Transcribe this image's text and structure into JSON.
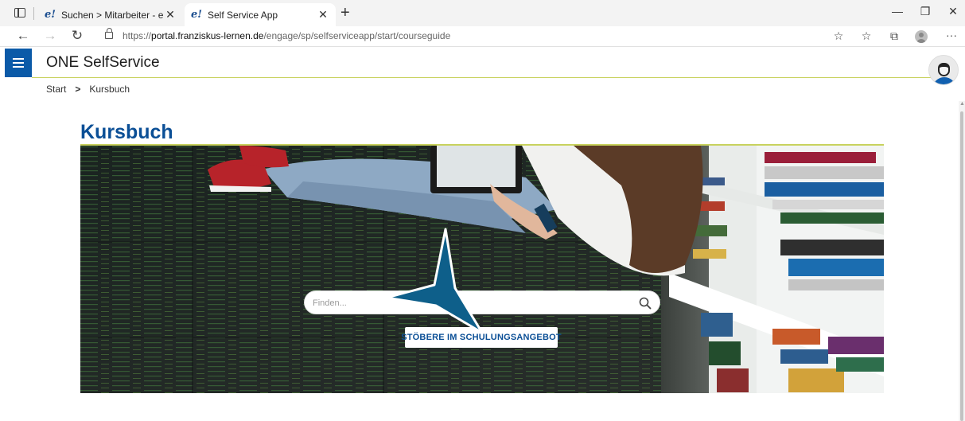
{
  "browser": {
    "tabs": [
      {
        "favicon": "e!",
        "title": "Suchen > Mitarbeiter - engage!",
        "close": "✕"
      },
      {
        "favicon": "e!",
        "title": "Self Service App",
        "close": "✕"
      }
    ],
    "new_tab": "+",
    "window_controls": {
      "minimize": "—",
      "maximize": "❐",
      "close": "✕"
    },
    "nav": {
      "back": "←",
      "forward": "→",
      "reload": "↻"
    },
    "url": {
      "prefix": "https://",
      "host": "portal.franziskus-lernen.de",
      "path": "/engage/sp/selfserviceapp/start/courseguide"
    },
    "toolbar_icons": [
      "add-favorite-icon",
      "favorites-icon",
      "collections-icon",
      "profile-icon",
      "more-icon"
    ],
    "toolbar_glyphs": {
      "add_favorite": "☆",
      "favorites": "☆",
      "collections": "⧉",
      "more": "···"
    }
  },
  "app": {
    "title": "ONE SelfService",
    "accent_color": "#0b5aa8",
    "underline_color": "#c8d25e"
  },
  "breadcrumb": {
    "items": [
      "Start",
      "Kursbuch"
    ],
    "separator": ">"
  },
  "page": {
    "title": "Kursbuch",
    "title_color": "#0b4f96"
  },
  "hero": {
    "image": "student-reading-tablet-bookshelf",
    "search": {
      "placeholder": "Finden...",
      "value": ""
    },
    "browse_button": "STÖBERE IM SCHULUNGSANGEBOT",
    "pointer_color": "#0e5f8a"
  }
}
